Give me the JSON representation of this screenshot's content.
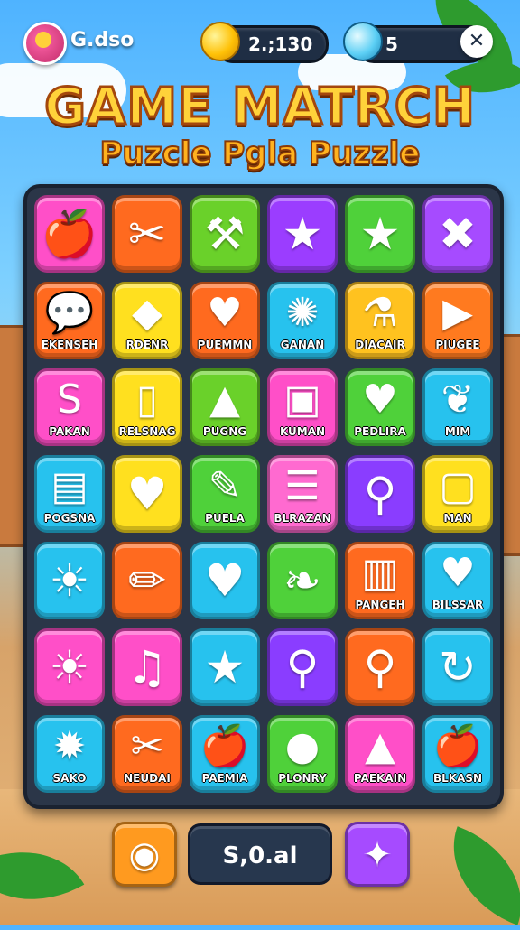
{
  "hud": {
    "player_name": "G.dso",
    "coins": "2.;130",
    "gems": "5",
    "close_label": "✕"
  },
  "title": {
    "main": "GAME MATRCH",
    "sub": "Puzcle Pgla Puzzle"
  },
  "board": {
    "columns": 6,
    "rows": 7,
    "tiles": [
      {
        "icon": "pomegranate-icon",
        "glyph": "🍎",
        "label": "",
        "color": "#ff4fc8"
      },
      {
        "icon": "crossed-tools-icon",
        "glyph": "✂",
        "label": "",
        "color": "#ff6a1f"
      },
      {
        "icon": "crossed-sticks-icon",
        "glyph": "⚒",
        "label": "",
        "color": "#6ad12a"
      },
      {
        "icon": "star-icon",
        "glyph": "★",
        "label": "",
        "color": "#9b3dff"
      },
      {
        "icon": "star-icon",
        "glyph": "★",
        "label": "",
        "color": "#4fd13a"
      },
      {
        "icon": "crossed-tools-icon",
        "glyph": "✖",
        "label": "",
        "color": "#a64bff"
      },
      {
        "icon": "speech-bubble-icon",
        "glyph": "💬",
        "label": "EKENSEH",
        "color": "#ff6a1f"
      },
      {
        "icon": "gem-icon",
        "glyph": "◆",
        "label": "RDENR",
        "color": "#ffe01f"
      },
      {
        "icon": "heart-icon",
        "glyph": "♥",
        "label": "PUEMMN",
        "color": "#ff6a1f"
      },
      {
        "icon": "sun-icon",
        "glyph": "✺",
        "label": "GANAN",
        "color": "#27c2ee"
      },
      {
        "icon": "potion-icon",
        "glyph": "⚗",
        "label": "DIACAIR",
        "color": "#ffc21f"
      },
      {
        "icon": "arrow-icon",
        "glyph": "▶",
        "label": "PIUGEE",
        "color": "#ff7a1f"
      },
      {
        "icon": "worm-icon",
        "glyph": "S",
        "label": "PAKAN",
        "color": "#ff4fc8"
      },
      {
        "icon": "phone-icon",
        "glyph": "▯",
        "label": "RELSNAG",
        "color": "#ffe01f"
      },
      {
        "icon": "cone-icon",
        "glyph": "▲",
        "label": "PUGNG",
        "color": "#6ad12a"
      },
      {
        "icon": "briefcase-icon",
        "glyph": "▣",
        "label": "KUMAN",
        "color": "#ff4fc8"
      },
      {
        "icon": "heart-icon",
        "glyph": "♥",
        "label": "PEDLIRA",
        "color": "#4fd13a"
      },
      {
        "icon": "leaf-icon",
        "glyph": "❦",
        "label": "MIM",
        "color": "#27c2ee"
      },
      {
        "icon": "map-icon",
        "glyph": "▤",
        "label": "POGSNA",
        "color": "#27c2ee"
      },
      {
        "icon": "heart-icon",
        "glyph": "♥",
        "label": "",
        "color": "#ffe01f"
      },
      {
        "icon": "pencil-icon",
        "glyph": "✎",
        "label": "PUELA",
        "color": "#4fd13a"
      },
      {
        "icon": "checklist-icon",
        "glyph": "☰",
        "label": "BLRAZAN",
        "color": "#ff6ad0"
      },
      {
        "icon": "dumbbell-icon",
        "glyph": "⚲",
        "label": "",
        "color": "#8a3dff"
      },
      {
        "icon": "tablet-icon",
        "glyph": "▢",
        "label": "MAN",
        "color": "#ffe01f"
      },
      {
        "icon": "sun-icon",
        "glyph": "☀",
        "label": "",
        "color": "#27c2ee"
      },
      {
        "icon": "pencil-icon",
        "glyph": "✏",
        "label": "",
        "color": "#ff6a1f"
      },
      {
        "icon": "heart-icon",
        "glyph": "♥",
        "label": "",
        "color": "#27c2ee"
      },
      {
        "icon": "leaf-icon",
        "glyph": "❧",
        "label": "",
        "color": "#4fd13a"
      },
      {
        "icon": "fence-icon",
        "glyph": "▥",
        "label": "PANGEH",
        "color": "#ff6a1f"
      },
      {
        "icon": "heart-icon",
        "glyph": "♥",
        "label": "BILSSAR",
        "color": "#27c2ee"
      },
      {
        "icon": "sun-icon",
        "glyph": "☀",
        "label": "",
        "color": "#ff4fc8"
      },
      {
        "icon": "music-note-icon",
        "glyph": "♫",
        "label": "",
        "color": "#ff4fc8"
      },
      {
        "icon": "star-icon",
        "glyph": "★",
        "label": "",
        "color": "#27c2ee"
      },
      {
        "icon": "dumbbell-icon",
        "glyph": "⚲",
        "label": "",
        "color": "#8a3dff"
      },
      {
        "icon": "magnifier-icon",
        "glyph": "⚲",
        "label": "",
        "color": "#ff6a1f"
      },
      {
        "icon": "refresh-icon",
        "glyph": "↻",
        "label": "",
        "color": "#27c2ee"
      },
      {
        "icon": "sun-icon",
        "glyph": "✹",
        "label": "SAKO",
        "color": "#27c2ee"
      },
      {
        "icon": "crossed-tools-icon",
        "glyph": "✂",
        "label": "NEUDAI",
        "color": "#ff6a1f"
      },
      {
        "icon": "apple-icon",
        "glyph": "🍎",
        "label": "PAEMIA",
        "color": "#27c2ee"
      },
      {
        "icon": "bean-icon",
        "glyph": "●",
        "label": "PLONRY",
        "color": "#4fd13a"
      },
      {
        "icon": "pyramid-icon",
        "glyph": "▲",
        "label": "PAEKAIN",
        "color": "#ff4fc8"
      },
      {
        "icon": "apple-icon",
        "glyph": "🍎",
        "label": "BLKASN",
        "color": "#27c2ee"
      }
    ]
  },
  "bottom": {
    "score": "S,0.al",
    "left_button_icon": "eye-icon",
    "right_button_icon": "cookie-icon",
    "left_color": "#ff9a1f",
    "right_color": "#a64bff"
  }
}
